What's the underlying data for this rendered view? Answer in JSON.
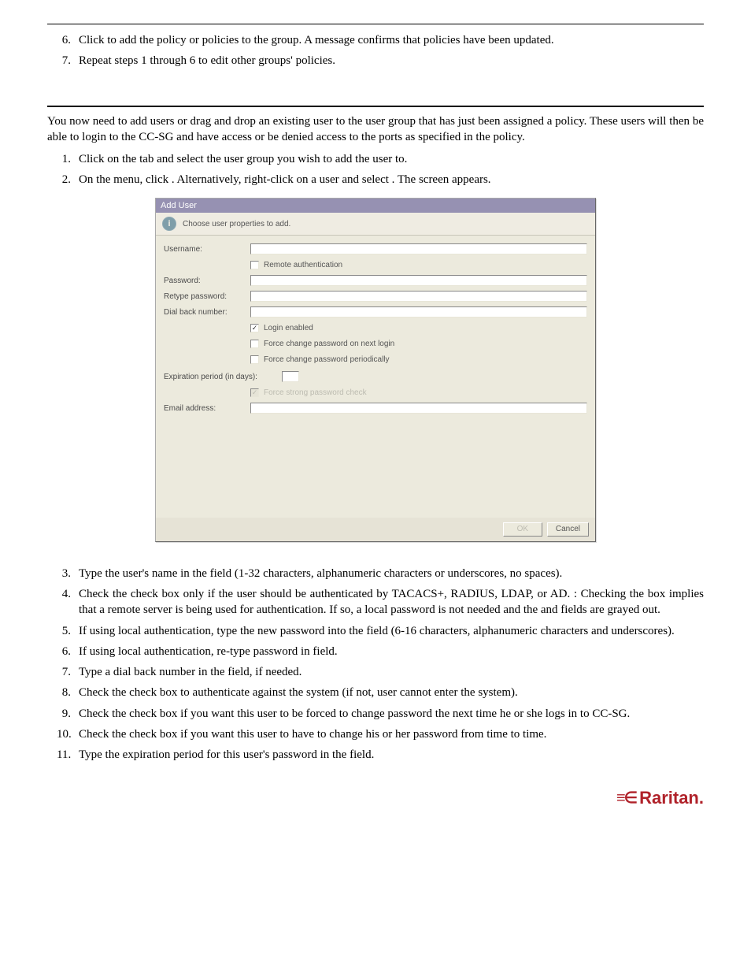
{
  "top_steps": [
    {
      "num": "6.",
      "text": "Click          to add the policy or policies to the group. A message confirms that policies have been updated."
    },
    {
      "num": "7.",
      "text": "Repeat steps 1 through 6 to edit other groups' policies."
    }
  ],
  "intro": "You now need to add users or drag and drop an existing user to the user group that has just been assigned a policy. These users will then be able to login to the CC-SG and have access or be denied access to the ports as specified in the policy.",
  "pre_dialog_steps": [
    {
      "num": "1.",
      "text": "Click on the            tab and select the user group you wish to add the user to."
    },
    {
      "num": "2.",
      "text": "On the           menu, click                 . Alternatively, right-click on a user and select                 . The                 screen appears."
    }
  ],
  "dialog": {
    "title": "Add User",
    "subtitle": "Choose user properties to add.",
    "labels": {
      "username": "Username:",
      "password": "Password:",
      "retype": "Retype password:",
      "dialback": "Dial back number:",
      "expiration": "Expiration period (in days):",
      "email": "Email address:"
    },
    "checks": {
      "remoteauth": "Remote authentication",
      "login": "Login enabled",
      "forcenext": "Force change password on next login",
      "forceperiod": "Force change password periodically",
      "strong": "Force strong password check"
    },
    "buttons": {
      "ok": "OK",
      "cancel": "Cancel"
    }
  },
  "post_dialog_steps": [
    {
      "num": "3.",
      "text": "Type the user's name in the                 field (1-32 characters, alphanumeric characters or underscores, no spaces)."
    },
    {
      "num": "4.",
      "text": "Check the                                 check box only if the user should be authenticated by TACACS+, RADIUS, LDAP, or AD.        : Checking the                                 box implies that a remote server is being used for authentication. If so, a local password is not needed and the                 and                         fields are grayed out."
    },
    {
      "num": "5.",
      "text": "If using local authentication, type the new password into the                 field (6-16 characters, alphanumeric characters and underscores)."
    },
    {
      "num": "6.",
      "text": "If using local authentication, re-type password in                         field."
    },
    {
      "num": "7.",
      "text": "Type a dial back number in the                         field, if needed."
    },
    {
      "num": "8.",
      "text": "Check the                     check box to authenticate against the system (if not, user cannot enter the system)."
    },
    {
      "num": "9.",
      "text": "Check the                                                     check box if you want this user to be forced to change password the next time he or she logs in to CC-SG."
    },
    {
      "num": "10.",
      "text": "Check the                                                     check box if you want this user to have to change his or her password from time to time."
    },
    {
      "num": "11.",
      "text": "Type the expiration period for this user's password in the                             field."
    }
  ],
  "brand": "Raritan."
}
